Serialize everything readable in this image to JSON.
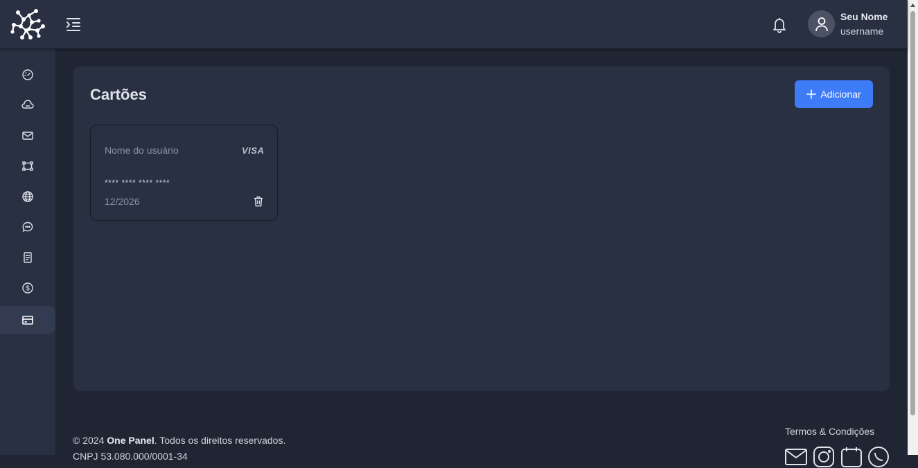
{
  "header": {
    "user_name": "Seu Nome",
    "user_login": "username"
  },
  "sidebar": {
    "items": [
      {
        "icon": "dashboard-gauge-icon"
      },
      {
        "icon": "cloud-icon"
      },
      {
        "icon": "mail-icon"
      },
      {
        "icon": "nodes-icon"
      },
      {
        "icon": "globe-icon"
      },
      {
        "icon": "chat-icon"
      },
      {
        "icon": "invoice-icon"
      },
      {
        "icon": "dollar-icon"
      },
      {
        "icon": "credit-card-icon",
        "active": true
      }
    ]
  },
  "main": {
    "title": "Cartões",
    "add_label": "Adicionar",
    "card": {
      "holder": "Nome do usuário",
      "brand": "VISA",
      "number": "**** **** **** ****",
      "expiry": "12/2026"
    }
  },
  "footer": {
    "copyright_prefix": "© 2024",
    "brand": "One Panel",
    "copyright_suffix": ". Todos os direitos reservados.",
    "cnpj": "CNPJ 53.080.000/0001-34",
    "terms": "Termos & Condições",
    "social": [
      "mail-icon",
      "instagram-icon",
      "calendar-icon",
      "whatsapp-icon"
    ]
  },
  "colors": {
    "background": "#1f2533",
    "surface": "#283042",
    "accent": "#3d7bf7"
  }
}
